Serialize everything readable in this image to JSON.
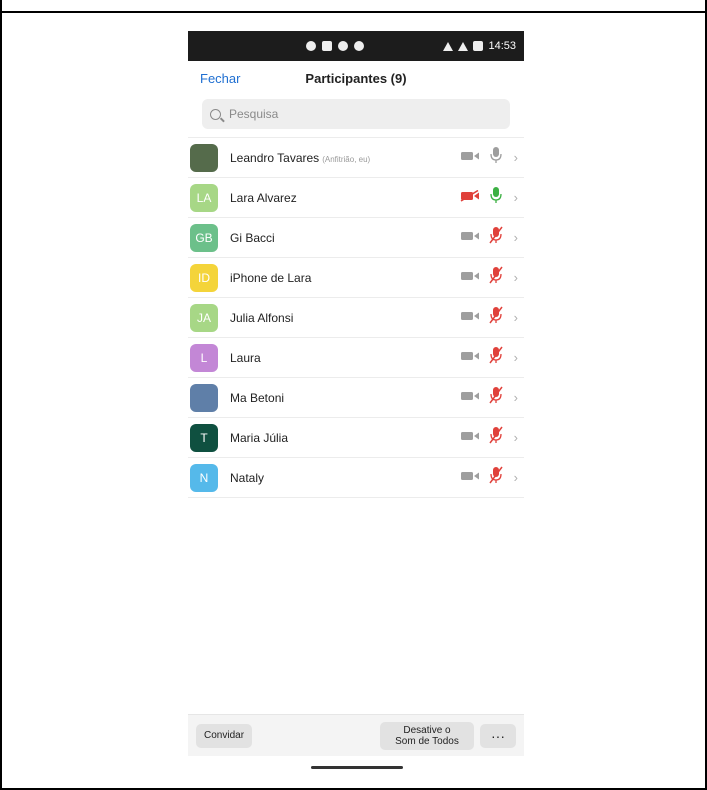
{
  "status_bar": {
    "time": "14:53"
  },
  "header": {
    "close_label": "Fechar",
    "title": "Participantes (9)"
  },
  "search": {
    "placeholder": "Pesquisa"
  },
  "participants": [
    {
      "name": "Leandro Tavares",
      "note": "(Anfitrião, eu)",
      "initials": "",
      "avatar_color": "#556b4b",
      "camera": "off-gray",
      "mic": "gray"
    },
    {
      "name": "Lara Alvarez",
      "note": "",
      "initials": "LA",
      "avatar_color": "#a7d786",
      "camera": "off-red",
      "mic": "green"
    },
    {
      "name": "Gi Bacci",
      "note": "",
      "initials": "GB",
      "avatar_color": "#6cc08a",
      "camera": "off-gray",
      "mic": "muted-red"
    },
    {
      "name": "iPhone de Lara",
      "note": "",
      "initials": "ID",
      "avatar_color": "#f4d43a",
      "camera": "off-gray",
      "mic": "muted-red"
    },
    {
      "name": "Julia Alfonsi",
      "note": "",
      "initials": "JA",
      "avatar_color": "#a7d786",
      "camera": "off-gray",
      "mic": "muted-red"
    },
    {
      "name": "Laura",
      "note": "",
      "initials": "L",
      "avatar_color": "#c387d6",
      "camera": "off-gray",
      "mic": "muted-red"
    },
    {
      "name": "Ma Betoni",
      "note": "",
      "initials": "",
      "avatar_color": "#5f7fa8",
      "camera": "off-gray",
      "mic": "muted-red"
    },
    {
      "name": "Maria Júlia",
      "note": "",
      "initials": "T",
      "avatar_color": "#0f5040",
      "camera": "off-gray",
      "mic": "muted-red"
    },
    {
      "name": "Nataly",
      "note": "",
      "initials": "N",
      "avatar_color": "#55b9ea",
      "camera": "off-gray",
      "mic": "muted-red"
    }
  ],
  "footer": {
    "invite_label": "Convidar",
    "mute_all_line1": "Desative o",
    "mute_all_line2": "Som de Todos",
    "more_label": "···"
  },
  "colors": {
    "accent": "#1f6fd1",
    "muted_red": "#e0413b",
    "active_green": "#3cb043",
    "icon_gray": "#9e9e9e"
  }
}
